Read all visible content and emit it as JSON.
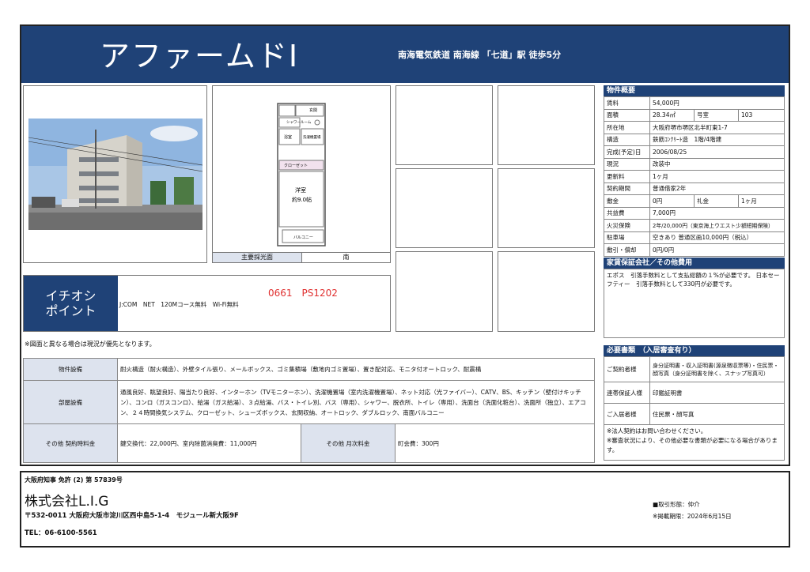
{
  "header": {
    "title": "アファームドⅠ",
    "station": "南海電気鉄道 南海線 「七道」駅 徒歩5分"
  },
  "floorplan": {
    "room_label": "洋室",
    "room_size": "約9.0帖",
    "balcony": "バルコニー",
    "closet": "クローゼット",
    "bath": "浴室",
    "entrance": "玄関",
    "shower": "シャワールーム",
    "washer": "洗濯機置場",
    "window_label": "主要採光面",
    "window_dir": "南"
  },
  "spec": {
    "title": "物件概要",
    "rent_label": "賃料",
    "rent": "54,000円",
    "area_label": "面積",
    "area": "28.34㎡",
    "room_no_label": "号室",
    "room_no": "103",
    "address_label": "所在地",
    "address": "大阪府堺市堺区北半町東1-7",
    "structure_label": "構造",
    "structure": "鉄筋ｺﾝｸﾘｰﾄ造　1階/4階建",
    "built_label": "完成(予定)日",
    "built": "2006/08/25",
    "status_label": "現況",
    "status": "改装中",
    "renewal_label": "更新料",
    "renewal": "1ヶ月",
    "contract_label": "契約期間",
    "contract": "普通借家2年",
    "deposit_label": "敷金",
    "deposit": "0円",
    "key_money_label": "礼金",
    "key_money": "1ヶ月",
    "common_label": "共益費",
    "common": "7,000円",
    "insurance_label": "火災保険",
    "insurance": "2年/20,000円（東京海上ウエスト少額短期保険）",
    "parking_label": "駐車場",
    "parking": "空きあり 普通区画10,000円（税込）",
    "shikibiki_label": "敷引・償却",
    "shikibiki": "0円/0円"
  },
  "guarantee": {
    "title": "家賃保証会社／その他費用",
    "text": "エポス　引落手数料として支払総額の１%が必要です。 日本セーフティー　引落手数料として330円が必要です。"
  },
  "docs": {
    "title": "必要書類　（入居審査有り）",
    "rows": [
      {
        "label": "ご契約者様",
        "value": "身分証明書・収入証明書(源泉徴収票等)・住民票・顔写真（身分証明書を除く、スナップ写真可）"
      },
      {
        "label": "連帯保証人様",
        "value": "印鑑証明書"
      },
      {
        "label": "ご入居者様",
        "value": "住民票・顔写真"
      }
    ],
    "note1": "※法人契約はお問い合わせください。",
    "note2": "※審査状況により、その他必要な書類が必要になる場合があります。"
  },
  "ichioshi": {
    "title_line1": "イチオシ",
    "title_line2": "ポイント",
    "code": "0661　PS1202",
    "text": "J:COM　NET　120Mコース無料　Wi-Fi無料"
  },
  "notice": "※図面と異なる場合は現況が優先となります。",
  "features": {
    "building_label": "物件設備",
    "building": "耐火構造（耐火構造）、外壁タイル張り、メールボックス、ゴミ集積場（敷地内ゴミ置場）、置き配対応、モニタ付オートロック、耐震構",
    "room_label": "部屋設備",
    "room": "通風良好、眺望良好、陽当たり良好、インターホン（TVモニターホン）、洗濯機置場（室内洗濯機置場）、ネット対応（光ファイバー）、CATV、BS、キッチン（壁付けキッチン）、コンロ（ガスコンロ）、給湯（ガス給湯）、３点給湯、バス・トイレ別、バス（専用）、シャワー、脱衣所、トイレ（専用）、洗面台（洗面化粧台）、洗面所（独立）、エアコン、２４時間換気システム、クローゼット、シューズボックス、玄関収納、オートロック、ダブルロック、南面バルコニー",
    "contract_fee_label": "その他 契約時料金",
    "contract_fee": "鍵交換代：22,000円、室内除菌消臭費：11,000円",
    "monthly_label": "その他 月次料金",
    "monthly": "町会費：300円"
  },
  "footer": {
    "license": "大阪府知事 免許 (2) 第 57839号",
    "company": "株式会社L.I.G",
    "address": "〒532-0011 大阪府大阪市淀川区西中島5-1-4　モジュール新大阪9F",
    "tel": "TEL：06-6100-5561",
    "mode": "■取引形態：仲介",
    "date": "※掲載期限：2024年6月15日"
  },
  "colors": {
    "header_bg": "#1f4277",
    "label_bg": "#dde3ee"
  }
}
